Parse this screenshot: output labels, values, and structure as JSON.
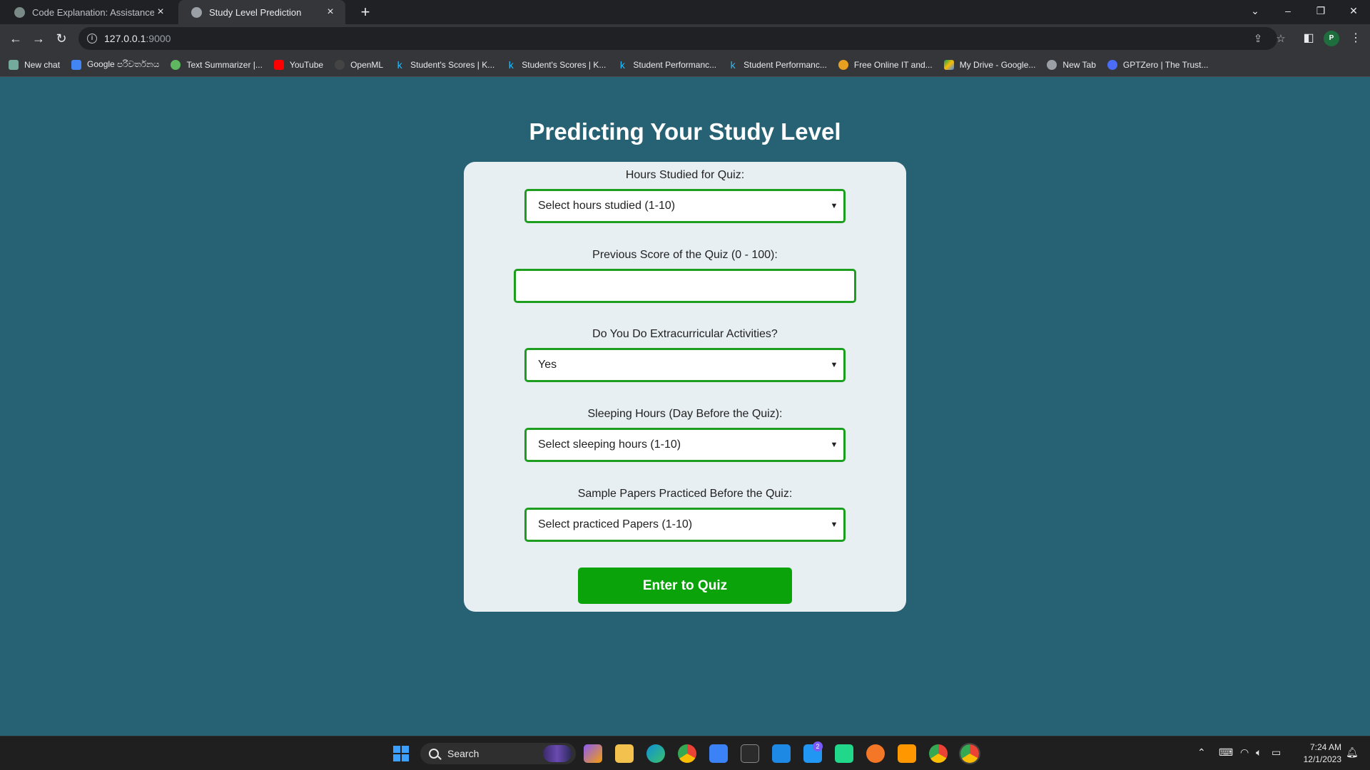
{
  "browser": {
    "tabs": [
      {
        "title": "Code Explanation: Assistance Pr",
        "active": false
      },
      {
        "title": "Study Level Prediction",
        "active": true
      }
    ],
    "url_host": "127.0.0.1",
    "url_port": ":9000",
    "bookmarks": [
      {
        "label": "New chat",
        "color": "#74aa9c"
      },
      {
        "label": "Google පරිවර්තනය",
        "color": "#4285f4"
      },
      {
        "label": "Text Summarizer |...",
        "color": "#5fb85f"
      },
      {
        "label": "YouTube",
        "color": "#ff0000"
      },
      {
        "label": "OpenML",
        "color": "#444444"
      },
      {
        "label": "Student's Scores | K...",
        "color": "#20beff"
      },
      {
        "label": "Student's Scores | K...",
        "color": "#20beff"
      },
      {
        "label": "Student Performanc...",
        "color": "#20beff"
      },
      {
        "label": "Student Performanc...",
        "color": "#20beff"
      },
      {
        "label": "Free Online IT and...",
        "color": "#e8a020"
      },
      {
        "label": "My Drive - Google...",
        "color": "#fbbc04"
      },
      {
        "label": "New Tab",
        "color": "#9aa0a6"
      },
      {
        "label": "GPTZero | The Trust...",
        "color": "#4a6cf7"
      }
    ],
    "profile_initial": "P"
  },
  "page": {
    "title": "Predicting Your Study Level",
    "fields": {
      "hours": {
        "label": "Hours Studied for Quiz:",
        "value": "Select hours studied (1-10)"
      },
      "score": {
        "label": "Previous Score of the Quiz (0 - 100):",
        "value": ""
      },
      "extra": {
        "label": "Do You Do Extracurricular Activities?",
        "value": "Yes"
      },
      "sleep": {
        "label": "Sleeping Hours (Day Before the Quiz):",
        "value": "Select sleeping hours (1-10)"
      },
      "papers": {
        "label": "Sample Papers Practiced Before the Quiz:",
        "value": "Select practiced Papers (1-10)"
      }
    },
    "submit_label": "Enter to Quiz"
  },
  "colors": {
    "page_bg": "#266174",
    "card_bg": "#e8eff2",
    "field_border": "#1e9e1e",
    "button_bg": "#0aa30a"
  },
  "taskbar": {
    "search_label": "Search",
    "mail_badge": "2",
    "time": "7:24 AM",
    "date": "12/1/2023"
  }
}
